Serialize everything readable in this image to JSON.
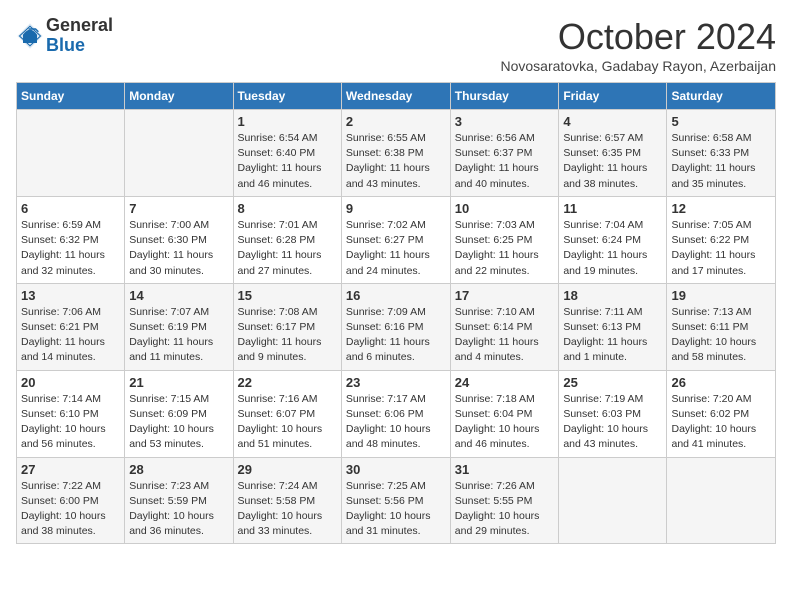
{
  "header": {
    "logo_general": "General",
    "logo_blue": "Blue",
    "month_title": "October 2024",
    "subtitle": "Novosaratovka, Gadabay Rayon, Azerbaijan"
  },
  "days_of_week": [
    "Sunday",
    "Monday",
    "Tuesday",
    "Wednesday",
    "Thursday",
    "Friday",
    "Saturday"
  ],
  "weeks": [
    [
      {
        "day": "",
        "info": ""
      },
      {
        "day": "",
        "info": ""
      },
      {
        "day": "1",
        "info": "Sunrise: 6:54 AM\nSunset: 6:40 PM\nDaylight: 11 hours and 46 minutes."
      },
      {
        "day": "2",
        "info": "Sunrise: 6:55 AM\nSunset: 6:38 PM\nDaylight: 11 hours and 43 minutes."
      },
      {
        "day": "3",
        "info": "Sunrise: 6:56 AM\nSunset: 6:37 PM\nDaylight: 11 hours and 40 minutes."
      },
      {
        "day": "4",
        "info": "Sunrise: 6:57 AM\nSunset: 6:35 PM\nDaylight: 11 hours and 38 minutes."
      },
      {
        "day": "5",
        "info": "Sunrise: 6:58 AM\nSunset: 6:33 PM\nDaylight: 11 hours and 35 minutes."
      }
    ],
    [
      {
        "day": "6",
        "info": "Sunrise: 6:59 AM\nSunset: 6:32 PM\nDaylight: 11 hours and 32 minutes."
      },
      {
        "day": "7",
        "info": "Sunrise: 7:00 AM\nSunset: 6:30 PM\nDaylight: 11 hours and 30 minutes."
      },
      {
        "day": "8",
        "info": "Sunrise: 7:01 AM\nSunset: 6:28 PM\nDaylight: 11 hours and 27 minutes."
      },
      {
        "day": "9",
        "info": "Sunrise: 7:02 AM\nSunset: 6:27 PM\nDaylight: 11 hours and 24 minutes."
      },
      {
        "day": "10",
        "info": "Sunrise: 7:03 AM\nSunset: 6:25 PM\nDaylight: 11 hours and 22 minutes."
      },
      {
        "day": "11",
        "info": "Sunrise: 7:04 AM\nSunset: 6:24 PM\nDaylight: 11 hours and 19 minutes."
      },
      {
        "day": "12",
        "info": "Sunrise: 7:05 AM\nSunset: 6:22 PM\nDaylight: 11 hours and 17 minutes."
      }
    ],
    [
      {
        "day": "13",
        "info": "Sunrise: 7:06 AM\nSunset: 6:21 PM\nDaylight: 11 hours and 14 minutes."
      },
      {
        "day": "14",
        "info": "Sunrise: 7:07 AM\nSunset: 6:19 PM\nDaylight: 11 hours and 11 minutes."
      },
      {
        "day": "15",
        "info": "Sunrise: 7:08 AM\nSunset: 6:17 PM\nDaylight: 11 hours and 9 minutes."
      },
      {
        "day": "16",
        "info": "Sunrise: 7:09 AM\nSunset: 6:16 PM\nDaylight: 11 hours and 6 minutes."
      },
      {
        "day": "17",
        "info": "Sunrise: 7:10 AM\nSunset: 6:14 PM\nDaylight: 11 hours and 4 minutes."
      },
      {
        "day": "18",
        "info": "Sunrise: 7:11 AM\nSunset: 6:13 PM\nDaylight: 11 hours and 1 minute."
      },
      {
        "day": "19",
        "info": "Sunrise: 7:13 AM\nSunset: 6:11 PM\nDaylight: 10 hours and 58 minutes."
      }
    ],
    [
      {
        "day": "20",
        "info": "Sunrise: 7:14 AM\nSunset: 6:10 PM\nDaylight: 10 hours and 56 minutes."
      },
      {
        "day": "21",
        "info": "Sunrise: 7:15 AM\nSunset: 6:09 PM\nDaylight: 10 hours and 53 minutes."
      },
      {
        "day": "22",
        "info": "Sunrise: 7:16 AM\nSunset: 6:07 PM\nDaylight: 10 hours and 51 minutes."
      },
      {
        "day": "23",
        "info": "Sunrise: 7:17 AM\nSunset: 6:06 PM\nDaylight: 10 hours and 48 minutes."
      },
      {
        "day": "24",
        "info": "Sunrise: 7:18 AM\nSunset: 6:04 PM\nDaylight: 10 hours and 46 minutes."
      },
      {
        "day": "25",
        "info": "Sunrise: 7:19 AM\nSunset: 6:03 PM\nDaylight: 10 hours and 43 minutes."
      },
      {
        "day": "26",
        "info": "Sunrise: 7:20 AM\nSunset: 6:02 PM\nDaylight: 10 hours and 41 minutes."
      }
    ],
    [
      {
        "day": "27",
        "info": "Sunrise: 7:22 AM\nSunset: 6:00 PM\nDaylight: 10 hours and 38 minutes."
      },
      {
        "day": "28",
        "info": "Sunrise: 7:23 AM\nSunset: 5:59 PM\nDaylight: 10 hours and 36 minutes."
      },
      {
        "day": "29",
        "info": "Sunrise: 7:24 AM\nSunset: 5:58 PM\nDaylight: 10 hours and 33 minutes."
      },
      {
        "day": "30",
        "info": "Sunrise: 7:25 AM\nSunset: 5:56 PM\nDaylight: 10 hours and 31 minutes."
      },
      {
        "day": "31",
        "info": "Sunrise: 7:26 AM\nSunset: 5:55 PM\nDaylight: 10 hours and 29 minutes."
      },
      {
        "day": "",
        "info": ""
      },
      {
        "day": "",
        "info": ""
      }
    ]
  ]
}
